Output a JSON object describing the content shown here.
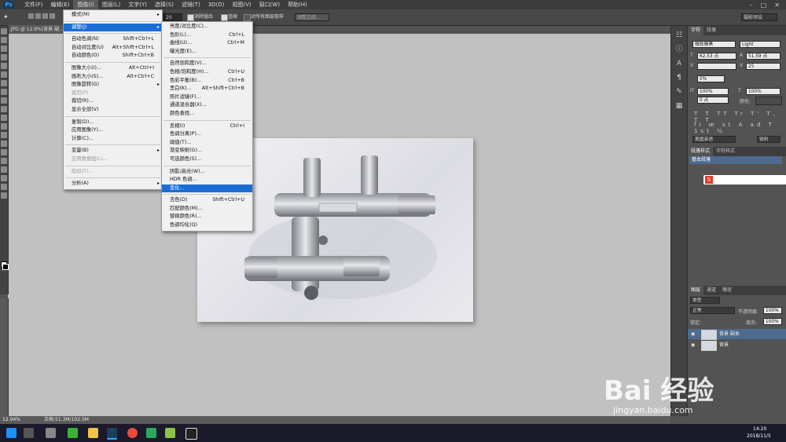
{
  "app": {
    "logo": "Ps"
  },
  "menubar": {
    "items": [
      "文件(F)",
      "编辑(E)",
      "图像(I)",
      "图层(L)",
      "文字(Y)",
      "选择(S)",
      "滤镜(T)",
      "3D(D)",
      "视图(V)",
      "窗口(W)",
      "帮助(H)"
    ]
  },
  "optbar": {
    "size_value": "20",
    "check1": "消除锯齿",
    "check2": "连续",
    "check3": "对所有图层取样",
    "refine_button": "调整边缘...",
    "workspace": "摄影预设"
  },
  "document": {
    "tab": ".JPG @ 12.9%(背景 副..."
  },
  "status": {
    "zoom": "12.94%",
    "doc_info": "文档:51.3M/102.5M"
  },
  "image_menu": {
    "items": [
      {
        "label": "模式(M)",
        "sc": "",
        "sub": true
      },
      {
        "sep": true
      },
      {
        "label": "调整(J)",
        "sc": "",
        "sub": true,
        "hl": true
      },
      {
        "sep": true
      },
      {
        "label": "自动色调(N)",
        "sc": "Shift+Ctrl+L"
      },
      {
        "label": "自动对比度(U)",
        "sc": "Alt+Shift+Ctrl+L"
      },
      {
        "label": "自动颜色(O)",
        "sc": "Shift+Ctrl+B"
      },
      {
        "sep": true
      },
      {
        "label": "图像大小(I)...",
        "sc": "Alt+Ctrl+I"
      },
      {
        "label": "画布大小(S)...",
        "sc": "Alt+Ctrl+C"
      },
      {
        "label": "图像旋转(G)",
        "sc": "",
        "sub": true
      },
      {
        "label": "裁剪(P)",
        "sc": "",
        "dis": true
      },
      {
        "label": "裁切(R)...",
        "sc": ""
      },
      {
        "label": "显示全部(V)",
        "sc": ""
      },
      {
        "sep": true
      },
      {
        "label": "复制(D)...",
        "sc": ""
      },
      {
        "label": "应用图像(Y)...",
        "sc": ""
      },
      {
        "label": "计算(C)...",
        "sc": ""
      },
      {
        "sep": true
      },
      {
        "label": "变量(B)",
        "sc": "",
        "sub": true
      },
      {
        "label": "应用数据组(L)...",
        "sc": "",
        "dis": true
      },
      {
        "sep": true
      },
      {
        "label": "陷印(T)...",
        "sc": "",
        "dis": true
      },
      {
        "sep": true
      },
      {
        "label": "分析(A)",
        "sc": "",
        "sub": true
      }
    ]
  },
  "adjust_menu": {
    "items": [
      {
        "label": "亮度/对比度(C)...",
        "sc": ""
      },
      {
        "label": "色阶(L)...",
        "sc": "Ctrl+L"
      },
      {
        "label": "曲线(U)...",
        "sc": "Ctrl+M"
      },
      {
        "label": "曝光度(E)...",
        "sc": ""
      },
      {
        "sep": true
      },
      {
        "label": "自然饱和度(V)...",
        "sc": ""
      },
      {
        "label": "色相/饱和度(H)...",
        "sc": "Ctrl+U"
      },
      {
        "label": "色彩平衡(B)...",
        "sc": "Ctrl+B"
      },
      {
        "label": "黑白(K)...",
        "sc": "Alt+Shift+Ctrl+B"
      },
      {
        "label": "照片滤镜(F)...",
        "sc": ""
      },
      {
        "label": "通道混合器(X)...",
        "sc": ""
      },
      {
        "label": "颜色查找...",
        "sc": ""
      },
      {
        "sep": true
      },
      {
        "label": "反相(I)",
        "sc": "Ctrl+I"
      },
      {
        "label": "色调分离(P)...",
        "sc": ""
      },
      {
        "label": "阈值(T)...",
        "sc": ""
      },
      {
        "label": "渐变映射(G)...",
        "sc": ""
      },
      {
        "label": "可选颜色(S)...",
        "sc": ""
      },
      {
        "sep": true
      },
      {
        "label": "阴影/高光(W)...",
        "sc": ""
      },
      {
        "label": "HDR 色调...",
        "sc": ""
      },
      {
        "label": "变化...",
        "sc": "",
        "hl": true
      },
      {
        "sep": true
      },
      {
        "label": "去色(D)",
        "sc": "Shift+Ctrl+U"
      },
      {
        "label": "匹配颜色(M)...",
        "sc": ""
      },
      {
        "label": "替换颜色(R)...",
        "sc": ""
      },
      {
        "label": "色调均化(Q)",
        "sc": ""
      }
    ]
  },
  "char_panel": {
    "tabs": [
      "字符",
      "段落"
    ],
    "font": "微软雅黑",
    "style": "Light",
    "size": "62.53 点",
    "leading": "51.59 点",
    "tracking": "25",
    "kerning": "0%",
    "vscale": "100%",
    "hscale": "100%",
    "baseline": "0 点",
    "color_label": "颜色:",
    "lang": "美国英语",
    "aa": "锐利"
  },
  "para_panel": {
    "tabs": [
      "段落样式",
      "字符样式"
    ],
    "item": "基本段落"
  },
  "layers_panel": {
    "tabs": [
      "图层",
      "通道",
      "路径"
    ],
    "filter": "类型",
    "blend": "正常",
    "opacity_label": "不透明度:",
    "opacity": "100%",
    "lock_label": "锁定:",
    "fill_label": "填充:",
    "fill": "100%",
    "layers": [
      {
        "name": "背景 副本",
        "active": true
      },
      {
        "name": "背景",
        "active": false
      }
    ]
  },
  "taskbar": {
    "time": "14:20",
    "date": "2018/11/5"
  },
  "watermark": {
    "brand": "Bai 经验",
    "url": "jingyan.baidu.com"
  },
  "colors": {
    "highlight": "#1c6ed4",
    "panel": "#535353",
    "canvas": "#c1c1c1"
  }
}
